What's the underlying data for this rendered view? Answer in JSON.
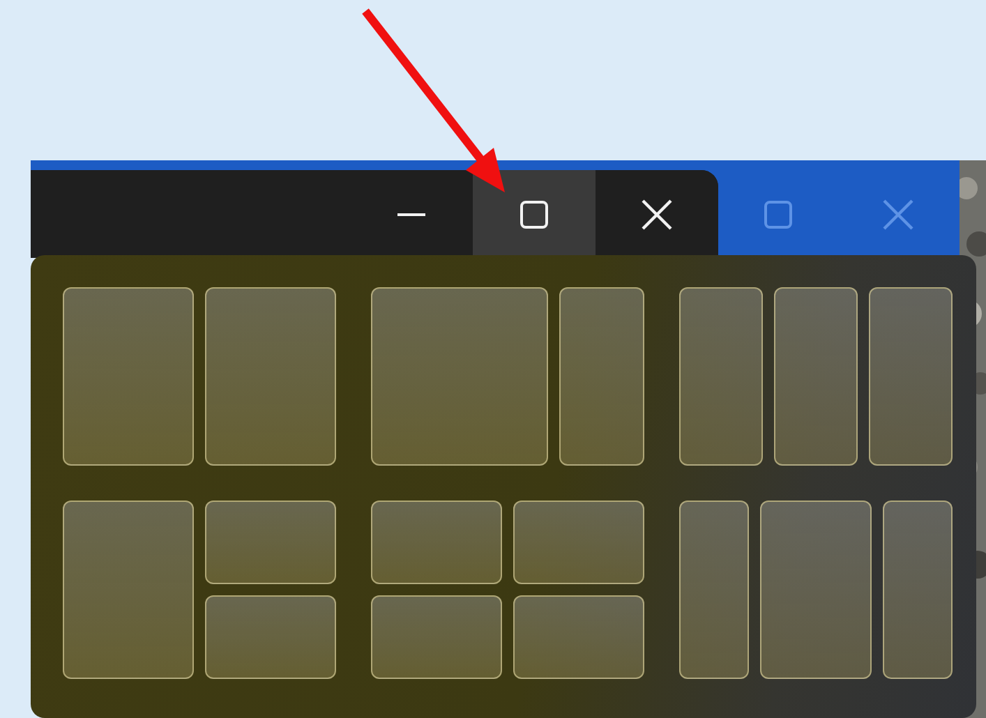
{
  "title_bar": {
    "buttons": [
      {
        "kind": "minimize",
        "selected": false
      },
      {
        "kind": "maximize",
        "selected": true
      },
      {
        "kind": "close",
        "selected": false
      }
    ]
  },
  "background_window": {
    "buttons": [
      {
        "kind": "maximize"
      },
      {
        "kind": "close"
      }
    ]
  },
  "snap_layouts": [
    {
      "kind": "halves"
    },
    {
      "kind": "two-thirds-left"
    },
    {
      "kind": "thirds"
    },
    {
      "kind": "left-half-right-quarters"
    },
    {
      "kind": "quarters"
    },
    {
      "kind": "wide-center"
    }
  ],
  "annotation": {
    "kind": "arrow"
  }
}
